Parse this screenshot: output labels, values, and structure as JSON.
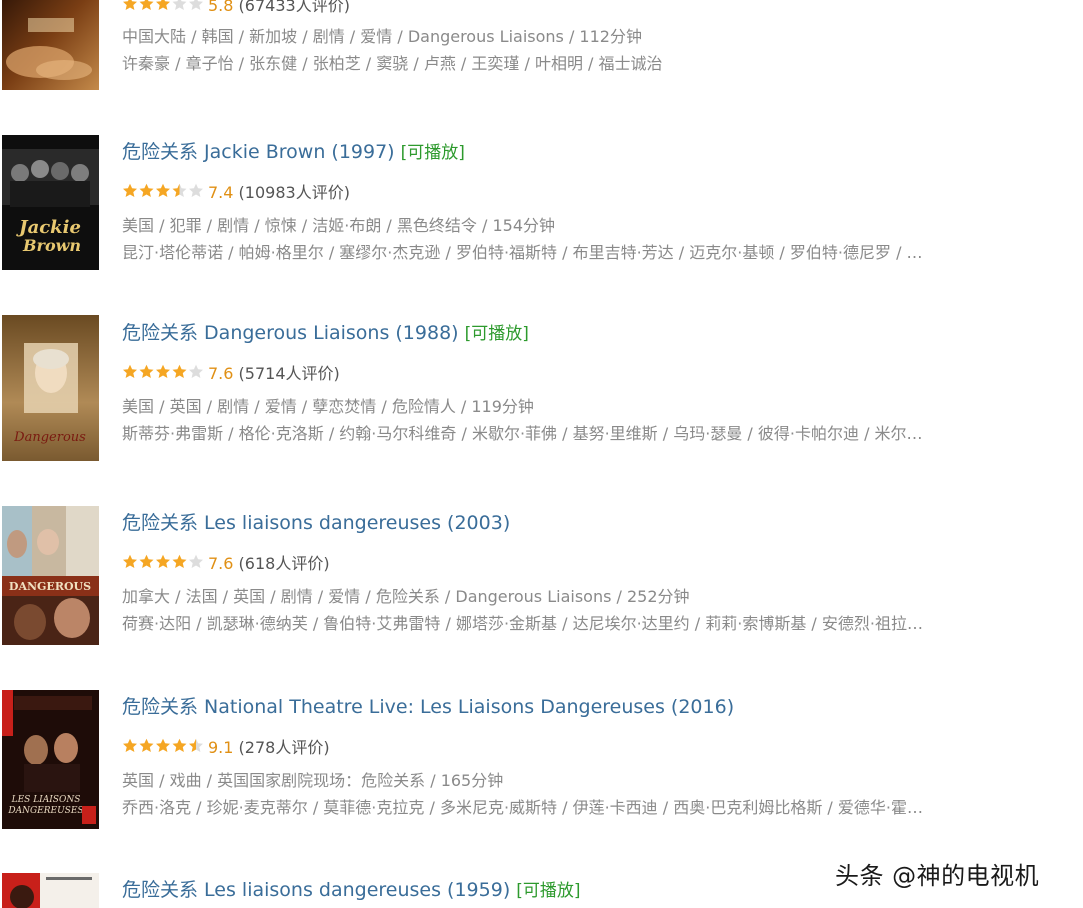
{
  "results": [
    {
      "title": "",
      "playable": "",
      "rating_stars": 3,
      "score": "5.8",
      "votes": "(67433人评价)",
      "meta": "中国大陆 / 韩国 / 新加坡 / 剧情 / 爱情 / Dangerous Liaisons / 112分钟",
      "cast": "许秦豪 / 章子怡 / 张东健 / 张柏芝 / 窦骁 / 卢燕 / 王奕瑾 / 叶相明 / 福士诚治",
      "poster_colors": [
        "#3a1a08",
        "#c48a4a"
      ]
    },
    {
      "title": "危险关系 Jackie Brown (1997)",
      "playable": "[可播放]",
      "rating_stars": 3.5,
      "score": "7.4",
      "votes": "(10983人评价)",
      "meta": "美国 / 犯罪 / 剧情 / 惊悚 / 洁姬·布朗 / 黑色终结令 / 154分钟",
      "cast": "昆汀·塔伦蒂诺 / 帕姆·格里尔 / 塞缪尔·杰克逊 / 罗伯特·福斯特 / 布里吉特·芳达 / 迈克尔·基顿 / 罗伯特·德尼罗 / …",
      "poster_colors": [
        "#111111",
        "#d0b060"
      ]
    },
    {
      "title": "危险关系 Dangerous Liaisons (1988)",
      "playable": "[可播放]",
      "rating_stars": 4,
      "score": "7.6",
      "votes": "(5714人评价)",
      "meta": "美国 / 英国 / 剧情 / 爱情 / 孽恋焚情 / 危险情人 / 119分钟",
      "cast": "斯蒂芬·弗雷斯 / 格伦·克洛斯 / 约翰·马尔科维奇 / 米歇尔·菲佛 / 基努·里维斯 / 乌玛·瑟曼 / 彼得·卡帕尔迪 / 米尔…",
      "poster_colors": [
        "#8a6a3a",
        "#d8b886"
      ]
    },
    {
      "title": "危险关系 Les liaisons dangereuses (2003)",
      "playable": "",
      "rating_stars": 4,
      "score": "7.6",
      "votes": "(618人评价)",
      "meta": "加拿大 / 法国 / 英国 / 剧情 / 爱情 / 危险关系 / Dangerous Liaisons / 252分钟",
      "cast": "荷赛·达阳 / 凯瑟琳·德纳芙 / 鲁伯特·艾弗雷特 / 娜塔莎·金斯基 / 达尼埃尔·达里约 / 莉莉·索博斯基 / 安德烈·祖拉…",
      "poster_colors": [
        "#c8c2b0",
        "#b04020"
      ]
    },
    {
      "title": "危险关系 National Theatre Live: Les Liaisons Dangereuses (2016)",
      "playable": "",
      "rating_stars": 4.5,
      "score": "9.1",
      "votes": "(278人评价)",
      "meta": "英国 / 戏曲 / 英国国家剧院现场：危险关系 / 165分钟",
      "cast": "乔西·洛克 / 珍妮·麦克蒂尔 / 莫菲德·克拉克 / 多米尼克·威斯特 / 伊莲·卡西迪 / 西奥·巴克利姆比格斯 / 爱德华·霍…",
      "poster_colors": [
        "#2a0e0a",
        "#c8201a"
      ]
    },
    {
      "title": "危险关系 Les liaisons dangereuses (1959)",
      "playable": "[可播放]",
      "rating_stars": 0,
      "score": "",
      "votes": "",
      "meta": "",
      "cast": "",
      "poster_colors": [
        "#f4f0ea",
        "#c8201a"
      ]
    }
  ],
  "watermark": "头条 @神的电视机",
  "colors": {
    "star_full": "#f5a623",
    "star_empty": "#dddddd",
    "title": "#3a6d99",
    "playable": "#2d9a2d",
    "score": "#e09015"
  }
}
